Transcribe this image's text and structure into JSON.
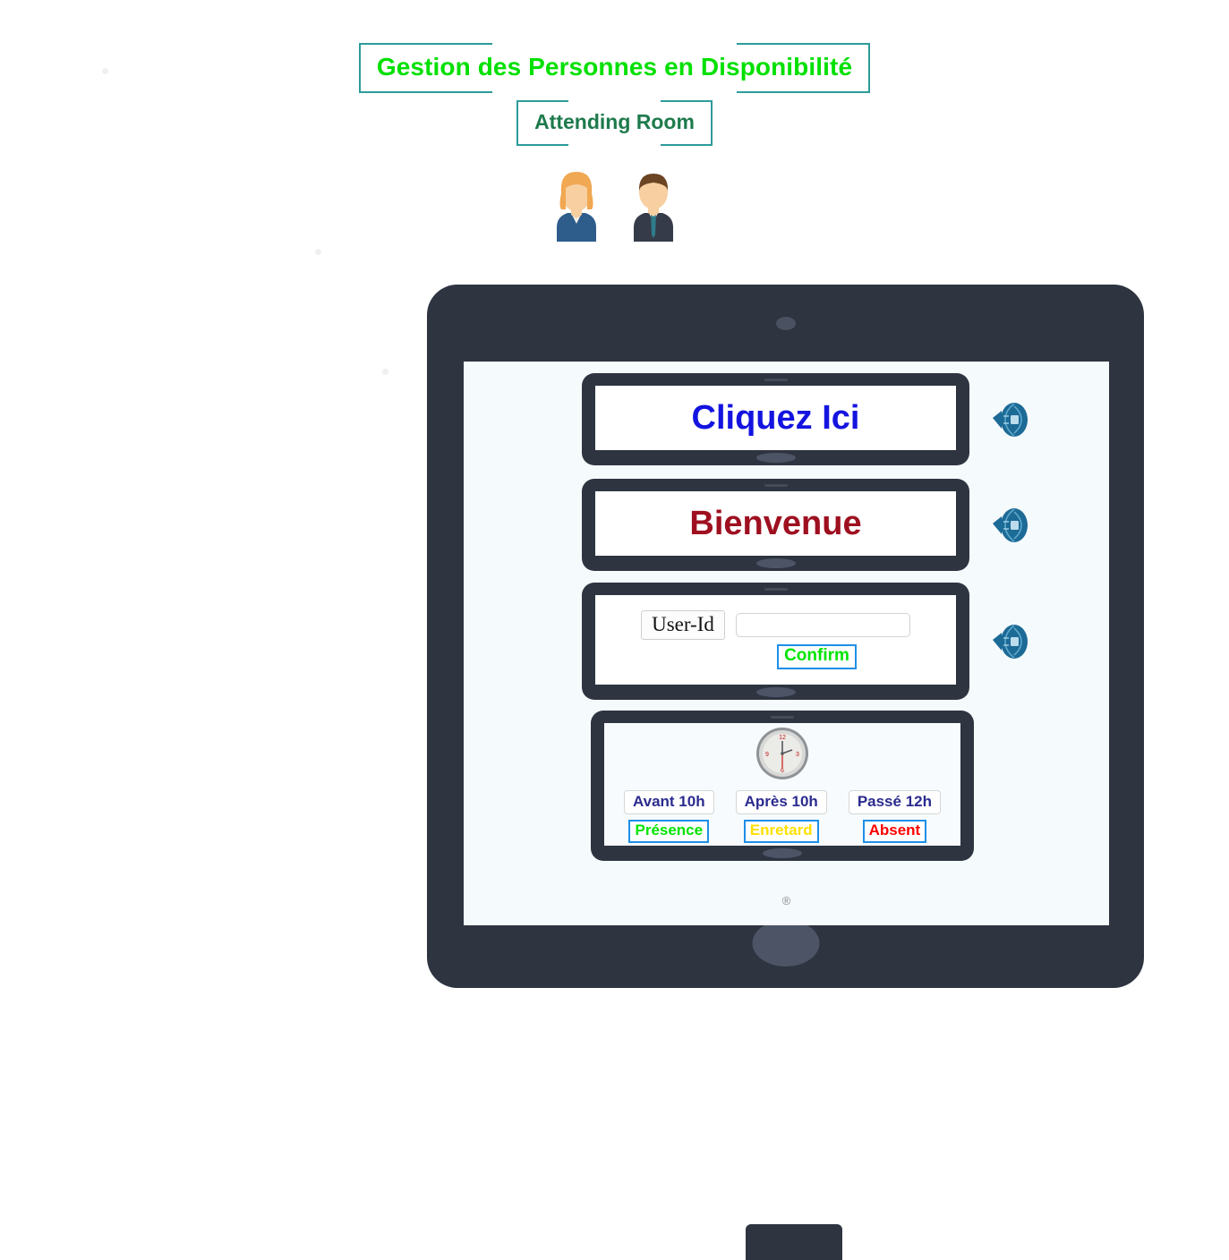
{
  "header": {
    "title": "Gestion des Personnes en Disponibilité",
    "subtitle": "Attending Room",
    "title_color": "#00e000",
    "subtitle_color": "#1d7a4c",
    "border_color": "#2e9b9b"
  },
  "avatars": [
    {
      "name": "business-woman-avatar",
      "hair": "#f0a852",
      "jacket": "#2e5d8c",
      "skin": "#f7cfa0"
    },
    {
      "name": "business-man-avatar",
      "hair": "#6b4423",
      "jacket": "#363b4a",
      "skin": "#f7cfa0"
    }
  ],
  "device": {
    "frame_color": "#2e3440",
    "screen_color": "#f5fafd",
    "registered_mark": "®"
  },
  "cards": [
    {
      "id": "cliquez-ici",
      "label": "Cliquez Ici",
      "color": "#1414e0",
      "icon": "speaker-icon"
    },
    {
      "id": "bienvenue",
      "label": "Bienvenue",
      "color": "#9e1020",
      "icon": "speaker-icon"
    }
  ],
  "login": {
    "label": "User-Id",
    "input_value": "",
    "input_placeholder": "",
    "confirm_label": "Confirm",
    "confirm_color": "#00e400",
    "confirm_border": "#1d8fe8",
    "icon": "speaker-icon"
  },
  "attendance": {
    "clock_icon": "analog-clock-icon",
    "columns": [
      {
        "time": "Avant 10h",
        "state": "Présence",
        "state_color": "#00e400"
      },
      {
        "time": "Après 10h",
        "state": "Enretard",
        "state_color": "#ffe000"
      },
      {
        "time": "Passé 12h",
        "state": "Absent",
        "state_color": "#ff0000"
      }
    ]
  }
}
